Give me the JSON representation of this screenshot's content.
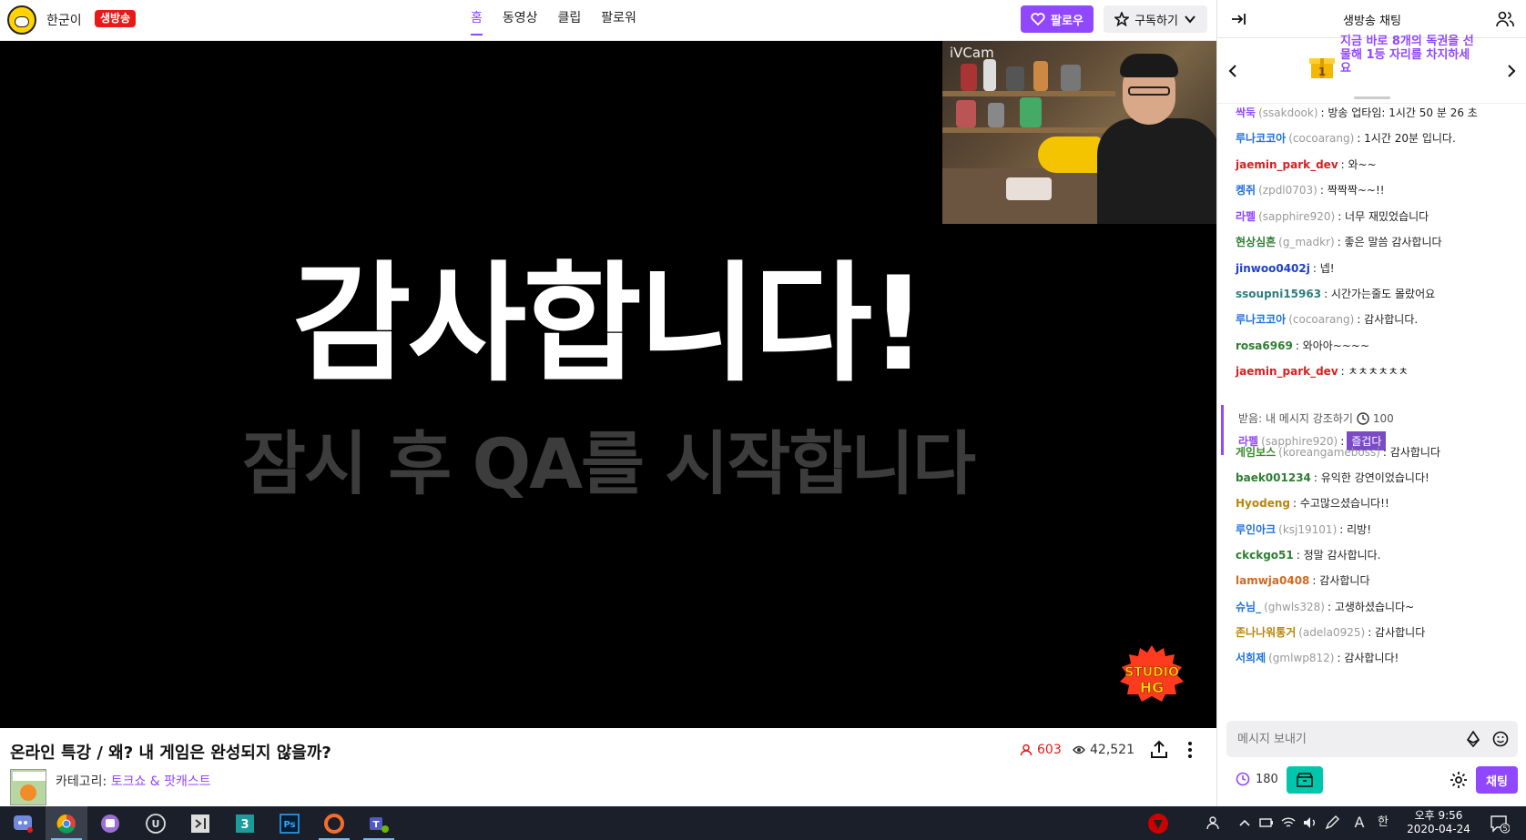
{
  "header": {
    "channel_name": "한군이",
    "live_badge": "생방송",
    "tabs": [
      "홈",
      "동영상",
      "클립",
      "팔로워"
    ],
    "follow_label": "팔로우",
    "subscribe_label": "구독하기"
  },
  "video": {
    "main_text": "감사합니다!",
    "sub_text": "잠시 후 QA를 시작합니다",
    "cam_label": "iVCam",
    "logo_text_1": "STUDIO",
    "logo_text_2": "HG"
  },
  "info": {
    "title": "온라인 특강 / 왜? 내 게임은 완성되지 않을까?",
    "viewers": "603",
    "views": "42,521",
    "category_label": "카테고리:",
    "category_value": "토크쇼 & 팟캐스트"
  },
  "chat": {
    "title": "생방송 채팅",
    "banner_text": "지금 바로 8개의 독권을 선물해 1등 자리를 차지하세요",
    "messages": [
      {
        "nick": "싹둑",
        "uid": "(ssakdook)",
        "text": ": 방송 업타임: 1시간 50 분 26 초",
        "color": "#9147ff"
      },
      {
        "nick": "루나코코아",
        "uid": "(cocoarang)",
        "text": ": 1시간 20분 입니다.",
        "color": "#1e6fd9"
      },
      {
        "nick": "jaemin_park_dev",
        "uid": "",
        "text": ": 와~~",
        "color": "#d62020"
      },
      {
        "nick": "켕쥐",
        "uid": "(zpdl0703)",
        "text": ": 짝짝짝~~!!",
        "color": "#1e6fd9"
      },
      {
        "nick": "라펠",
        "uid": "(sapphire920)",
        "text": ": 너무 재밌었습니다",
        "color": "#9147ff"
      },
      {
        "nick": "현상심흔",
        "uid": "(g_madkr)",
        "text": ": 좋은 말씀 감사합니다",
        "color": "#2e7d32"
      },
      {
        "nick": "jinwoo0402j",
        "uid": "",
        "text": ": 넵!",
        "color": "#1e40c8"
      },
      {
        "nick": "ssoupni15963",
        "uid": "",
        "text": ": 시간가는줄도 몰랐어요",
        "color": "#2e7d7d"
      },
      {
        "nick": "루나코코아",
        "uid": "(cocoarang)",
        "text": ": 감사합니다.",
        "color": "#1e6fd9"
      },
      {
        "nick": "rosa6969",
        "uid": "",
        "text": ": 와아아~~~~",
        "color": "#2e7d32"
      },
      {
        "nick": "jaemin_park_dev",
        "uid": "",
        "text": ": ㅊㅊㅊㅊㅊㅊ",
        "color": "#d62020"
      },
      {
        "nick": "게임보스",
        "uid": "(koreangameboss)",
        "text": ": 감사합니다",
        "color": "#3a8a2a"
      },
      {
        "nick": "baek001234",
        "uid": "",
        "text": ": 유익한 강연이었습니다!",
        "color": "#2e7d32"
      },
      {
        "nick": "Hyodeng",
        "uid": "",
        "text": ": 수고많으셨습니다!!",
        "color": "#b8860b"
      },
      {
        "nick": "루인아크",
        "uid": "(ksj19101)",
        "text": ": 리방!",
        "color": "#1e6fd9"
      },
      {
        "nick": "ckckgo51",
        "uid": "",
        "text": ": 정말 감사합니다.",
        "color": "#2e7d32"
      },
      {
        "nick": "lamwja0408",
        "uid": "",
        "text": ": 감사합니다",
        "color": "#d2691e"
      },
      {
        "nick": "슈님_",
        "uid": "(ghwls328)",
        "text": ": 고생하셨습니다~",
        "color": "#1e6fd9"
      },
      {
        "nick": "존나나워통거",
        "uid": "(adela0925)",
        "text": ": 감사합니다",
        "color": "#b8860b"
      },
      {
        "nick": "서희제",
        "uid": "(gmlwp812)",
        "text": ": 감사합니다!",
        "color": "#1e6fd9"
      }
    ],
    "highlight": {
      "label": "받음: 내 메시지 강조하기",
      "points": "100",
      "nick": "라펠",
      "uid": "(sapphire920)",
      "chip": "즐겁다"
    },
    "input_placeholder": "메시지 보내기",
    "points_value": "180",
    "send_label": "채팅"
  },
  "taskbar": {
    "clock_time": "오후 9:56",
    "clock_date": "2020-04-24",
    "notif_count": "5",
    "ime_label": "A",
    "ime_korean": "한",
    "apps": [
      "discord",
      "chrome",
      "twitch",
      "unreal",
      "visual-studio",
      "3dsmax",
      "photoshop",
      "origin",
      "teams"
    ]
  }
}
